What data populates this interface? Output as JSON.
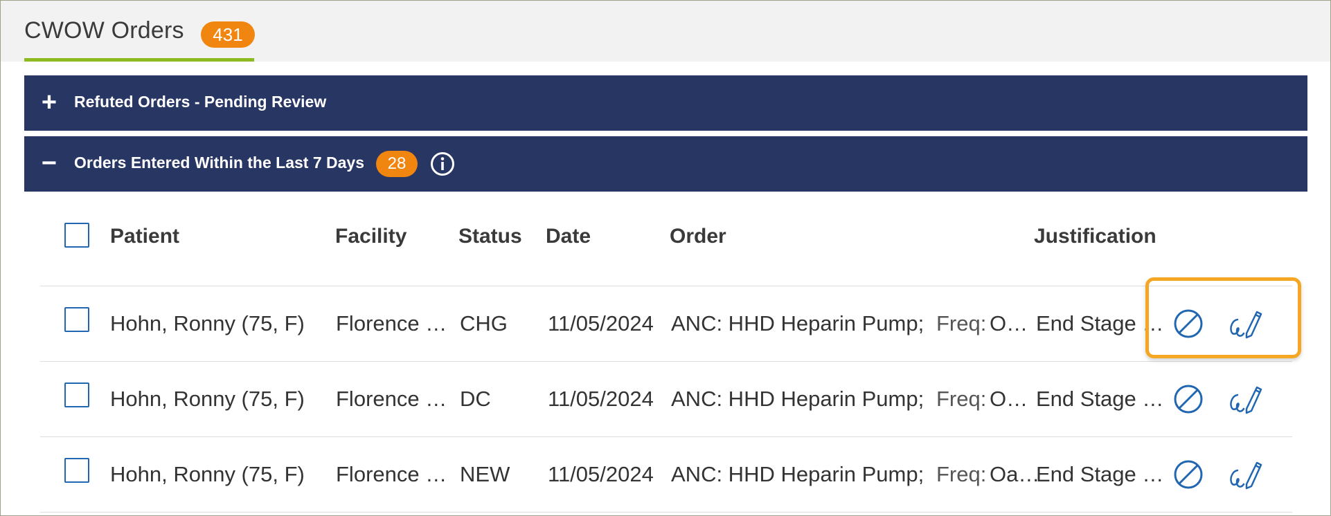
{
  "tab": {
    "title": "CWOW Orders",
    "count": "431"
  },
  "sections": [
    {
      "toggle": "+",
      "title": "Refuted Orders - Pending Review"
    },
    {
      "toggle": "−",
      "title": "Orders Entered Within the Last 7 Days",
      "count": "28"
    }
  ],
  "table": {
    "headers": {
      "patient": "Patient",
      "facility": "Facility",
      "status": "Status",
      "date": "Date",
      "order": "Order",
      "justification": "Justification"
    },
    "rows": [
      {
        "patient": "Hohn, Ronny (75, F)",
        "facility": "Florence …",
        "status": "CHG",
        "date": "11/05/2024",
        "order": "ANC: HHD Heparin Pump;",
        "freq_label": "Freq:",
        "freq_value": "O…",
        "justification": "End Stage …"
      },
      {
        "patient": "Hohn, Ronny (75, F)",
        "facility": "Florence …",
        "status": "DC",
        "date": "11/05/2024",
        "order": "ANC: HHD Heparin Pump;",
        "freq_label": "Freq:",
        "freq_value": "O…",
        "justification": "End Stage …"
      },
      {
        "patient": "Hohn, Ronny (75, F)",
        "facility": "Florence …",
        "status": "NEW",
        "date": "11/05/2024",
        "order": "ANC: HHD Heparin Pump;",
        "freq_label": "Freq:",
        "freq_value": "Oa…",
        "justification": "End Stage …"
      }
    ]
  },
  "icons": {
    "refute": "prohibited-circle-icon",
    "sign": "signature-pen-icon",
    "info": "info-circle-icon"
  },
  "colors": {
    "bar_background": "#283663",
    "badge": "#f0850f",
    "tab_underline": "#8dbb1f",
    "icon_blue": "#2166b0",
    "highlight": "#f5a623"
  }
}
